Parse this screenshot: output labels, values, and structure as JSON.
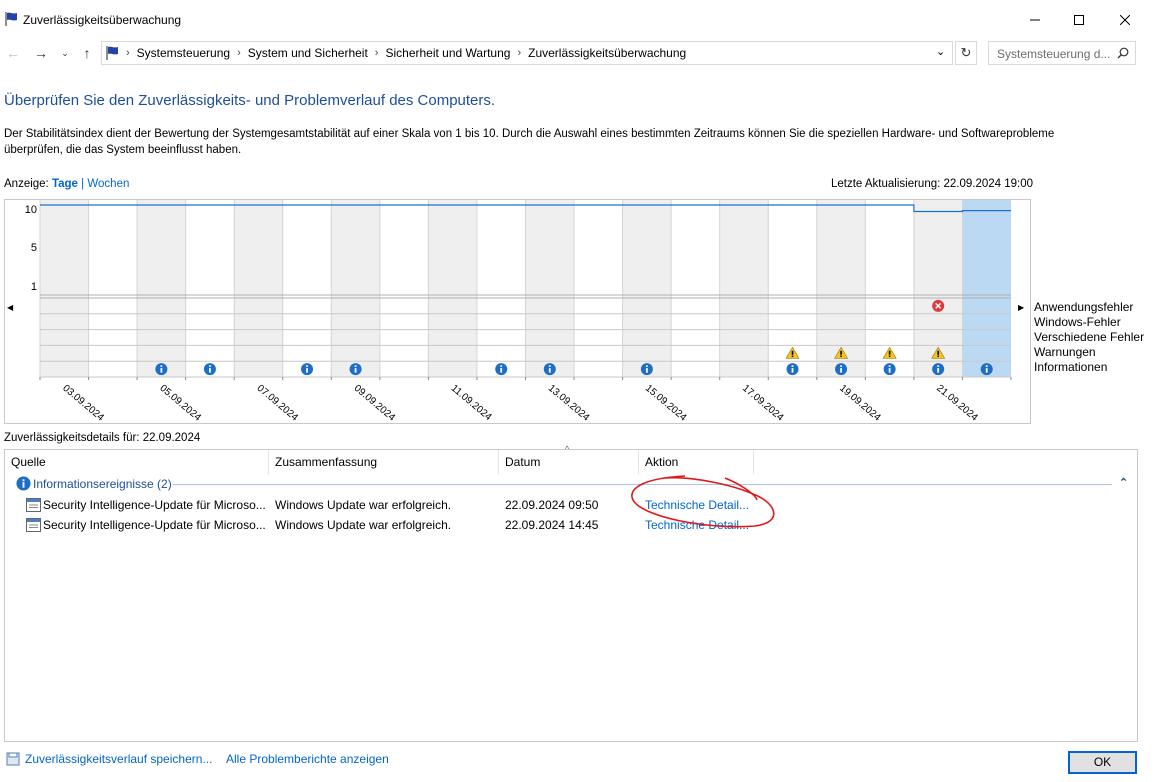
{
  "window": {
    "title": "Zuverlässigkeitsüberwachung"
  },
  "address": {
    "breadcrumbs": [
      "Systemsteuerung",
      "System und Sicherheit",
      "Sicherheit und Wartung",
      "Zuverlässigkeitsüberwachung"
    ],
    "search_placeholder": "Systemsteuerung d..."
  },
  "page": {
    "heading": "Überprüfen Sie den Zuverlässigkeits- und Problemverlauf des Computers.",
    "description": "Der Stabilitätsindex dient der Bewertung der Systemgesamtstabilität auf einer Skala von 1 bis 10. Durch die Auswahl eines bestimmten Zeitraums können Sie die speziellen Hardware- und Softwareprobleme überprüfen, die das System beeinflusst haben."
  },
  "view": {
    "label": "Anzeige:",
    "days": "Tage",
    "sep": "|",
    "weeks": "Wochen"
  },
  "last_update": "Letzte Aktualisierung: 22.09.2024 19:00",
  "chart_data": {
    "type": "line",
    "y_ticks": [
      "10",
      "5",
      "1"
    ],
    "ylim": [
      1,
      10
    ],
    "columns": 20,
    "stability_values": [
      10,
      10,
      10,
      10,
      10,
      10,
      10,
      10,
      10,
      10,
      10,
      10,
      10,
      10,
      10,
      10,
      10,
      10,
      9.3,
      9.4
    ],
    "date_labels": [
      "03.09.2024",
      "05.09.2024",
      "07.09.2024",
      "09.09.2024",
      "11.09.2024",
      "13.09.2024",
      "15.09.2024",
      "17.09.2024",
      "19.09.2024",
      "21.09.2024"
    ],
    "rows": [
      "Anwendungsfehler",
      "Windows-Fehler",
      "Verschiedene Fehler",
      "Warnungen",
      "Informationen"
    ],
    "events": {
      "errors": [
        18
      ],
      "warnings": [
        15,
        16,
        17,
        18
      ],
      "information": [
        2,
        3,
        5,
        6,
        9,
        10,
        12,
        15,
        16,
        17,
        18,
        19
      ]
    },
    "selected_column": 19
  },
  "details": {
    "title": "Zuverlässigkeitsdetails für: 22.09.2024",
    "columns": [
      "Quelle",
      "Zusammenfassung",
      "Datum",
      "Aktion"
    ],
    "group": "Informationsereignisse (2)",
    "rows": [
      {
        "source": "Security Intelligence-Update für Microso...",
        "summary": "Windows Update war erfolgreich.",
        "date": "22.09.2024 09:50",
        "action": "Technische Detail..."
      },
      {
        "source": "Security Intelligence-Update für Microso...",
        "summary": "Windows Update war erfolgreich.",
        "date": "22.09.2024 14:45",
        "action": "Technische Detail..."
      }
    ]
  },
  "footer": {
    "save_link": "Zuverlässigkeitsverlauf speichern...",
    "reports_link": "Alle Problemberichte anzeigen",
    "ok": "OK"
  },
  "colors": {
    "accent": "#0066cc",
    "heading": "#1f4e99",
    "selected": "#bcd9f4",
    "line": "#1a73c9"
  }
}
